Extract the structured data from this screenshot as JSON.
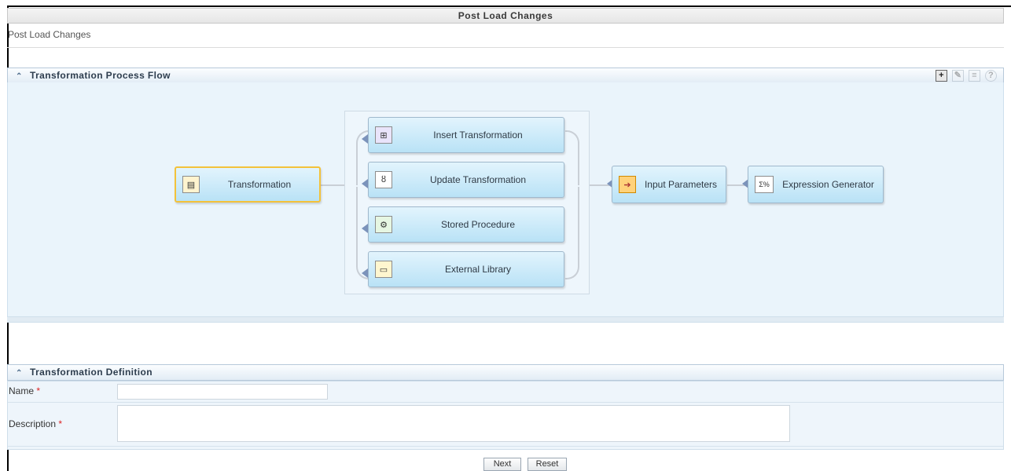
{
  "page": {
    "title": "Post Load Changes",
    "breadcrumb": "Post Load Changes"
  },
  "process_flow": {
    "title": "Transformation Process Flow",
    "toolbar": [
      {
        "name": "add-icon",
        "label": "+",
        "state": "active"
      },
      {
        "name": "edit-icon",
        "label": "✎",
        "state": "disabled"
      },
      {
        "name": "delete-icon",
        "label": "≡",
        "state": "disabled"
      },
      {
        "name": "help-icon",
        "label": "?",
        "state": "disabled"
      }
    ],
    "nodes": {
      "transformation": "Transformation",
      "insert": "Insert Transformation",
      "update": "Update Transformation",
      "stored_procedure": "Stored Procedure",
      "external_library": "External Library",
      "input_parameters": "Input Parameters",
      "expression_generator": "Expression Generator"
    },
    "icons": {
      "transformation": "▤",
      "insert": "⊞",
      "update": "ȣ",
      "stored_procedure": "⚙",
      "external_library": "▭",
      "input_parameters": "➔",
      "expression_generator": "Σ%"
    },
    "colors": {
      "selected_border": "#f3c23a",
      "node_fill": "#b9e2f6",
      "area": "#eaf4fb"
    }
  },
  "definition": {
    "title": "Transformation Definition",
    "name_label": "Name",
    "name_value": "",
    "description_label": "Description",
    "description_value": "",
    "required_marker": "*"
  },
  "buttons": {
    "next": "Next",
    "reset": "Reset"
  }
}
